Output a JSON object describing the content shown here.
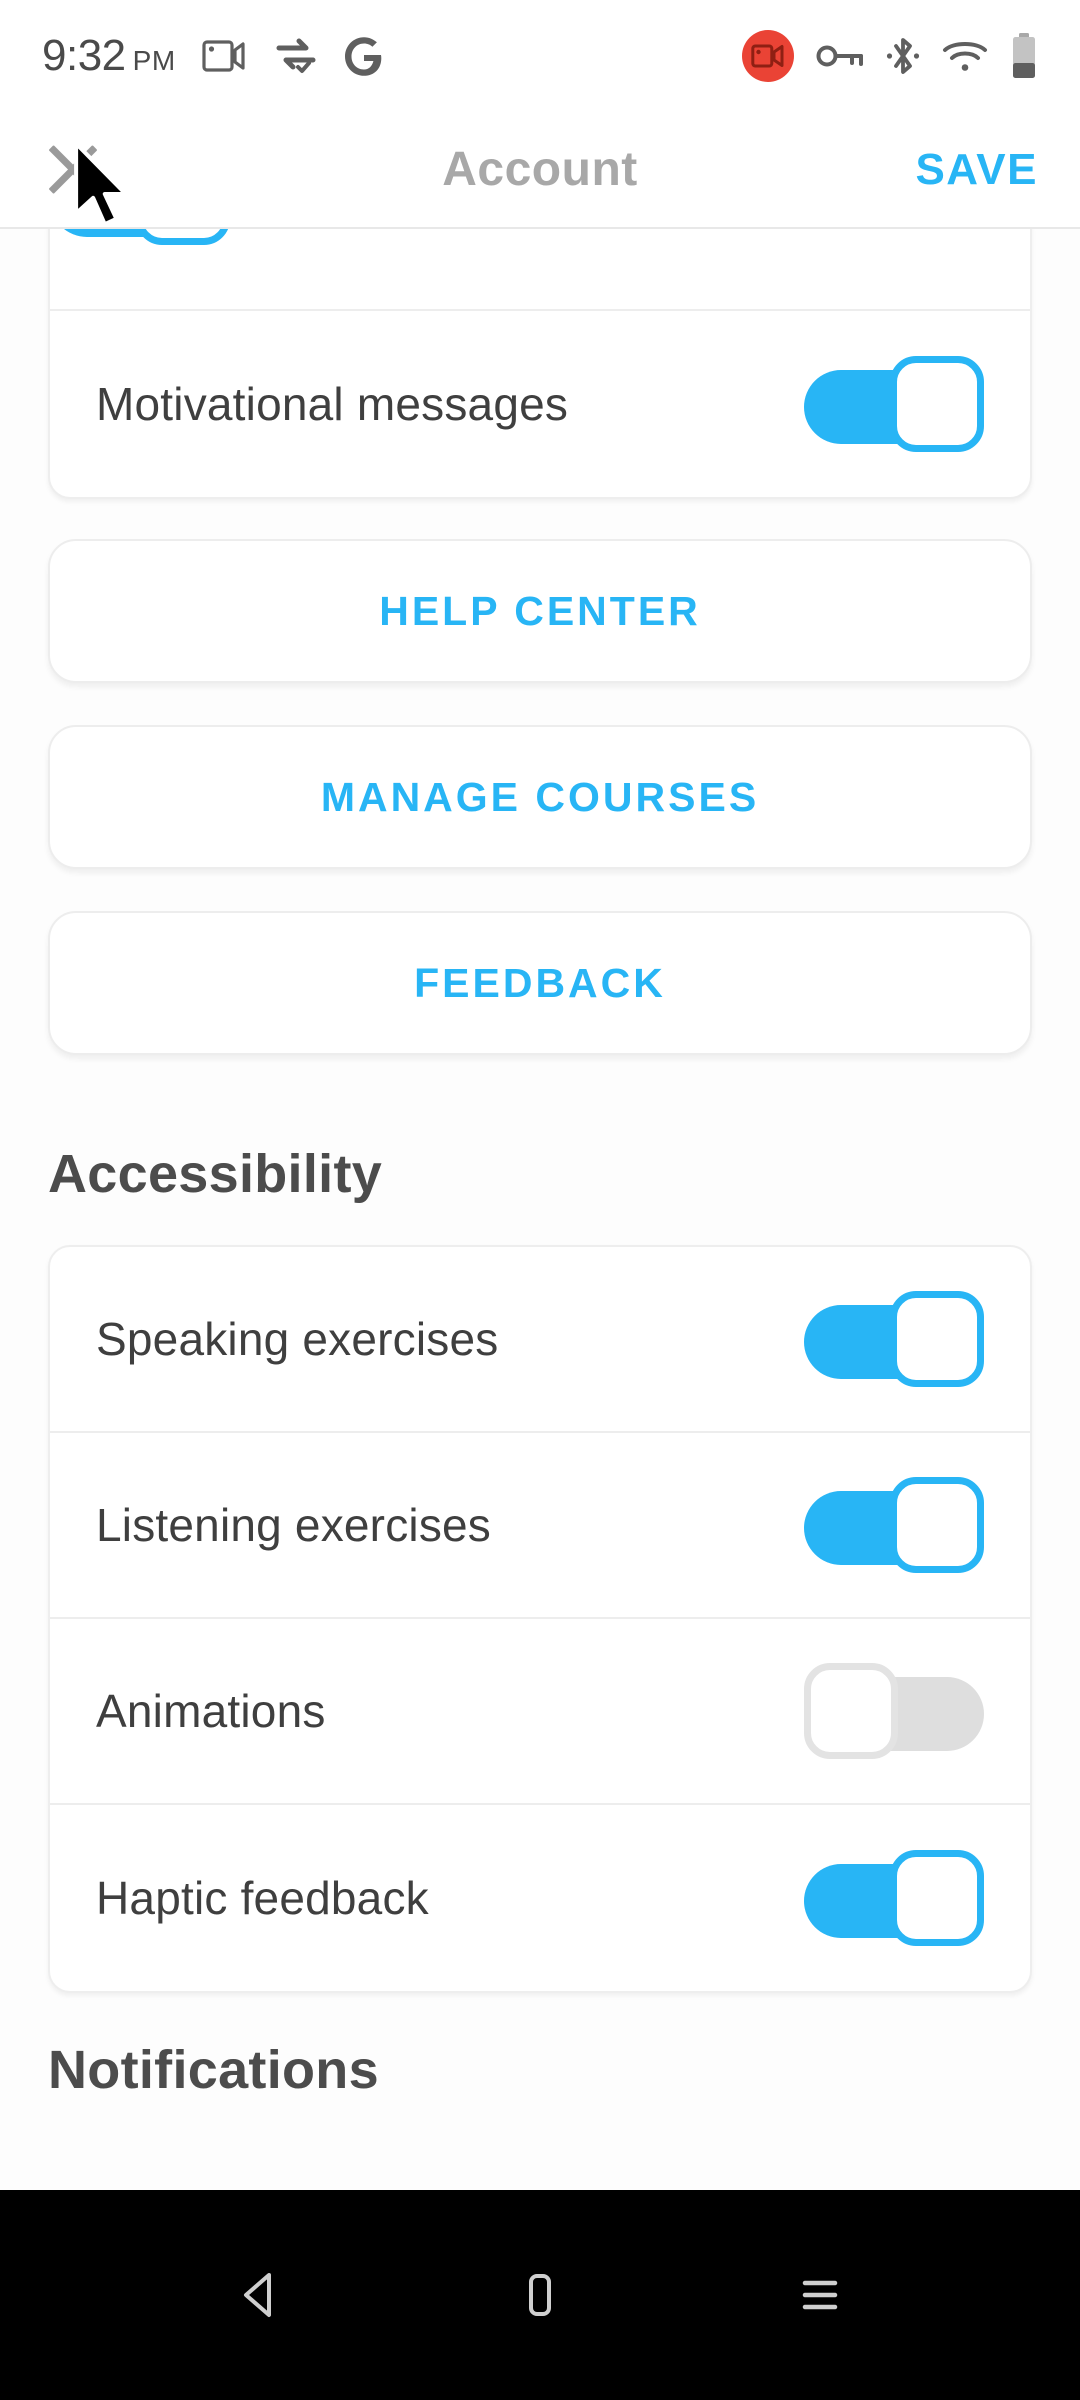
{
  "status_bar": {
    "time": "9:32",
    "meridiem": "PM",
    "left_icons": [
      "video-camera-icon",
      "vpn-sync-icon",
      "google-g-icon"
    ],
    "right_icons": [
      "screen-record-icon",
      "vpn-key-icon",
      "bluetooth-icon",
      "wifi-icon",
      "battery-icon"
    ]
  },
  "app_bar": {
    "close_label": "close",
    "title": "Account",
    "save_label": "SAVE"
  },
  "settings": {
    "clipped_row_above": {
      "toggle_state": "on"
    },
    "preferences_card": [
      {
        "label": "Motivational messages",
        "toggle_state": "on"
      }
    ],
    "action_buttons": [
      {
        "label": "HELP CENTER",
        "name": "help-center-button"
      },
      {
        "label": "MANAGE COURSES",
        "name": "manage-courses-button"
      },
      {
        "label": "FEEDBACK",
        "name": "feedback-button"
      }
    ],
    "sections": [
      {
        "title": "Accessibility",
        "rows": [
          {
            "label": "Speaking exercises",
            "toggle_state": "on"
          },
          {
            "label": "Listening exercises",
            "toggle_state": "on"
          },
          {
            "label": "Animations",
            "toggle_state": "off"
          },
          {
            "label": "Haptic feedback",
            "toggle_state": "on"
          }
        ]
      },
      {
        "title": "Notifications",
        "rows": []
      }
    ]
  },
  "nav_bar": {
    "buttons": [
      "back-icon",
      "home-icon",
      "recents-icon"
    ]
  },
  "colors": {
    "accent_blue": "#28b5f5",
    "toggle_off_gray": "#dedede",
    "text_dark": "#3f3f3f",
    "title_gray": "#a8a8a8",
    "heading_gray": "#4c4c4c",
    "record_red": "#ea4335",
    "page_bg": "#fdfdfd",
    "nav_bg": "#000000"
  }
}
